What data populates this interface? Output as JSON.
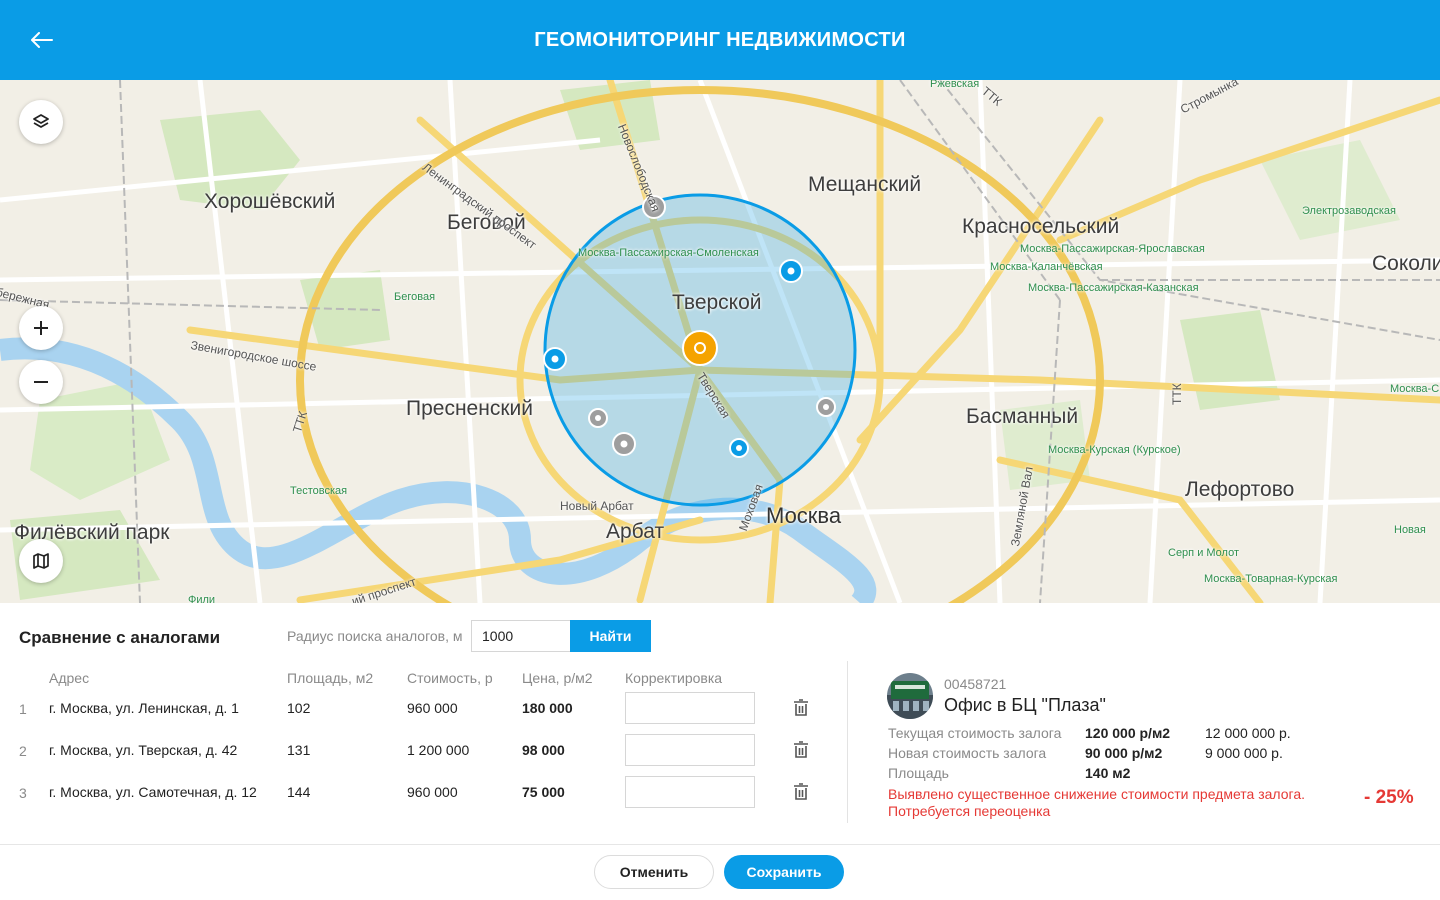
{
  "header": {
    "title": "ГЕОМОНИТОРИНГ НЕДВИЖИМОСТИ",
    "back_icon": "arrow-left-icon"
  },
  "map": {
    "districts": [
      "Хорошёвский",
      "Беговой",
      "Мещанский",
      "Красносельский",
      "Соколина",
      "Тверской",
      "Пресненский",
      "Басманный",
      "Лефортово",
      "Арбат",
      "Филёвский парк"
    ],
    "city": "Москва",
    "stations": [
      "Ржевская",
      "Электрозаводская",
      "Москва-Пассажирская-Ярославская",
      "Москва-Каланчёвская",
      "Москва-Пассажирская-Казанская",
      "Москва-Пассажирская-Смоленская",
      "Беговая",
      "Москва-С",
      "Москва-Курская (Курское)",
      "Тестовская",
      "Серп и Молот",
      "Новая",
      "Москва-Товарная-Курская",
      "Фили"
    ],
    "streets": [
      "Ленинградский проспект",
      "Новослободская",
      "Звенигородское шоссе",
      "Тверская",
      "Новый Арбат",
      "Моховая",
      "Земляной Вал",
      "ТТК",
      "Стромынка",
      "ТТК",
      "ТТК",
      "бережная",
      "ий проспект"
    ],
    "controls": {
      "layers": "layers-icon",
      "zoom_in": "plus-icon",
      "zoom_out": "minus-icon",
      "map_type": "map-icon"
    }
  },
  "panel": {
    "title": "Сравнение с аналогами",
    "radius_label": "Радиус поиска аналогов, м",
    "radius_value": "1000",
    "find_label": "Найти",
    "columns": {
      "address": "Адрес",
      "area": "Площадь, м2",
      "cost": "Стоимость, р",
      "price": "Цена, р/м2",
      "correction": "Корректировка"
    },
    "rows": [
      {
        "num": "1",
        "address": "г. Москва, ул. Ленинская, д. 1",
        "area": "102",
        "cost": "960 000",
        "price": "180 000",
        "correction": ""
      },
      {
        "num": "2",
        "address": "г. Москва, ул. Тверская, д. 42",
        "area": "131",
        "cost": "1 200 000",
        "price": "98 000",
        "correction": ""
      },
      {
        "num": "3",
        "address": "г. Москва, ул. Самотечная, д. 12",
        "area": "144",
        "cost": "960 000",
        "price": "75 000",
        "correction": ""
      }
    ]
  },
  "object": {
    "id": "00458721",
    "name": "Офис в БЦ \"Плаза\"",
    "current_label": "Текущая стоимость залога",
    "current_per_m2": "120 000 р/м2",
    "current_total": "12 000 000 р.",
    "new_label": "Новая стоимость залога",
    "new_per_m2": "90 000 р/м2",
    "new_total": "9 000 000 р.",
    "area_label": "Площадь",
    "area_value": "140 м2",
    "warning_line1": "Выявлено существенное снижение стоимости предмета залога.",
    "warning_line2": "Потребуется переоценка",
    "delta": "- 25%"
  },
  "footer": {
    "cancel_label": "Отменить",
    "save_label": "Сохранить"
  },
  "colors": {
    "accent": "#0a9ce6",
    "warning": "#e53935",
    "marker_main": "#f5a300",
    "marker_gray": "#9e9e9e"
  }
}
